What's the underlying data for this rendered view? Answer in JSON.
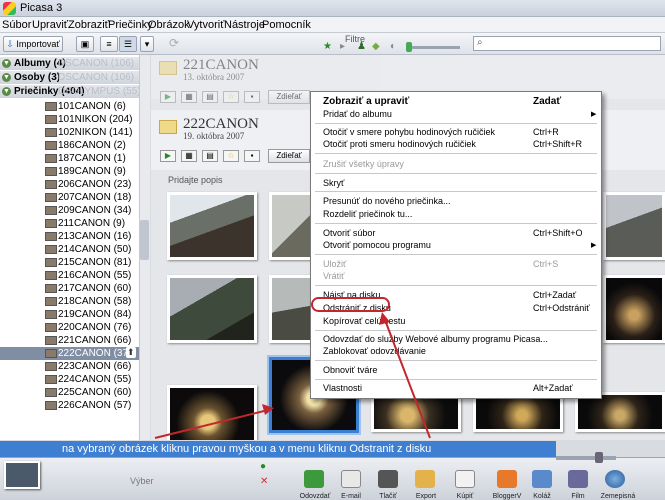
{
  "window": {
    "title": "Picasa 3"
  },
  "menu": [
    "Súbor",
    "Upraviť",
    "Zobraziť",
    "Priečinky",
    "Obrázok",
    "Vytvoriť",
    "Nástroje",
    "Pomocník"
  ],
  "toolbar": {
    "import_label": "Importovať",
    "filter_label": "Filtre"
  },
  "sidebar": {
    "groups": [
      {
        "label": "Albumy (4)",
        "ghost": "DSCANON (106)"
      },
      {
        "label": "Osoby (3)",
        "ghost": "DSCANON (106)"
      },
      {
        "label": "Priečinky (404)",
        "ghost": "DSOLYMPUS (55)"
      }
    ],
    "folders": [
      "101CANON (6)",
      "101NIKON (204)",
      "102NIKON (141)",
      "186CANON (2)",
      "187CANON (1)",
      "189CANON (9)",
      "206CANON (23)",
      "207CANON (18)",
      "209CANON (34)",
      "211CANON (9)",
      "213CANON (16)",
      "214CANON (50)",
      "215CANON (81)",
      "216CANON (55)",
      "217CANON (60)",
      "218CANON (58)",
      "219CANON (84)",
      "220CANON (76)",
      "221CANON (66)",
      "222CANON (37)",
      "223CANON (66)",
      "224CANON (55)",
      "225CANON (60)",
      "226CANON (57)"
    ],
    "selected_index": 19
  },
  "main": {
    "folder1": {
      "name": "221CANON",
      "date": "13. októbra 2007"
    },
    "folder2": {
      "name": "222CANON",
      "date": "19. októbra 2007"
    },
    "share_label": "Zdieľať",
    "caption_hint": "Pridajte popis"
  },
  "context_menu": {
    "items": [
      {
        "label": "Zobraziť a upraviť",
        "shortcut": "Zadať",
        "bold": true
      },
      {
        "label": "Pridať do albumu",
        "shortcut": "",
        "submenu": true
      },
      {
        "label": "Otočiť v smere pohybu hodinových ručičiek",
        "shortcut": "Ctrl+R"
      },
      {
        "label": "Otočiť proti smeru hodinových ručičiek",
        "shortcut": "Ctrl+Shift+R"
      },
      {
        "label": "Zrušiť všetky úpravy",
        "shortcut": "",
        "disabled": true
      },
      {
        "label": "Skryť",
        "shortcut": ""
      },
      {
        "label": "Presunúť do nového priečinka...",
        "shortcut": ""
      },
      {
        "label": "Rozdeliť priečinok tu...",
        "shortcut": ""
      },
      {
        "label": "Otvoriť súbor",
        "shortcut": "Ctrl+Shift+O"
      },
      {
        "label": "Otvoriť pomocou programu",
        "shortcut": "",
        "submenu": true
      },
      {
        "label": "Uložiť",
        "shortcut": "Ctrl+S",
        "disabled": true
      },
      {
        "label": "Vrátiť",
        "shortcut": "",
        "disabled": true
      },
      {
        "label": "Nájsť na disku",
        "shortcut": "Ctrl+Zadať"
      },
      {
        "label": "Odstrániť z disku",
        "shortcut": "Ctrl+Odstrániť"
      },
      {
        "label": "Kopírovať celú cestu",
        "shortcut": ""
      },
      {
        "label": "Odovzdať do služby Webové albumy programu Picasa...",
        "shortcut": ""
      },
      {
        "label": "Zablokovať odovzdávanie",
        "shortcut": ""
      },
      {
        "label": "Obnoviť tváre",
        "shortcut": ""
      },
      {
        "label": "Vlastnosti",
        "shortcut": "Alt+Zadať"
      }
    ]
  },
  "annotation": "na vybraný obrázek kliknu pravou myškou a v menu kliknu  Odstranit z disku",
  "bottom": {
    "selection_label": "Výber",
    "actions": [
      "Odovzdať",
      "E-mail",
      "Tlačiť",
      "Export",
      "Kúpiť",
      "BloggerV",
      "Koláž",
      "Film",
      "Zemepisná"
    ]
  },
  "colors": {
    "annotation_bg": "#3e7fd1",
    "highlight_circle": "#c2272d",
    "selected_folder": "#7f8ea3"
  }
}
